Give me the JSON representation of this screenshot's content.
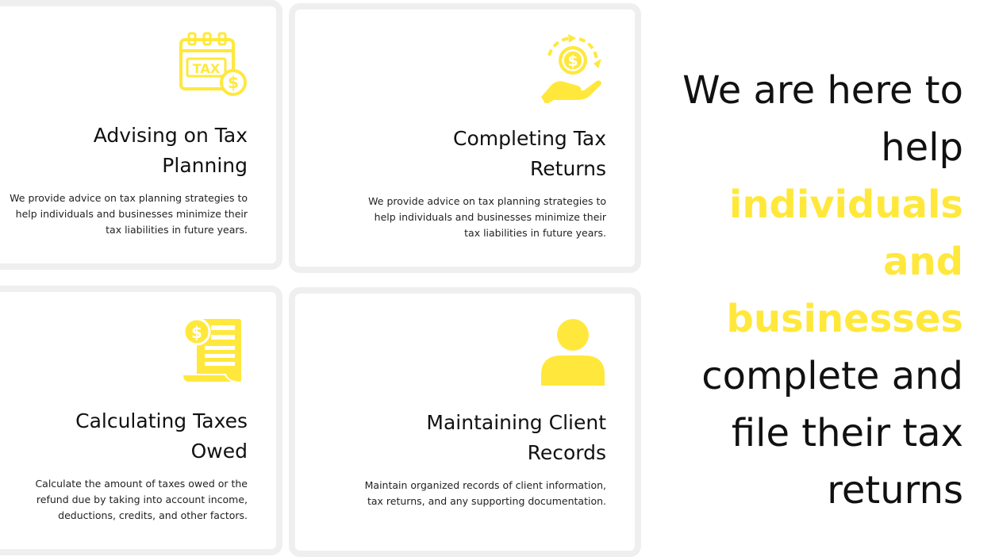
{
  "colors": {
    "accent": "#ffe83b",
    "card_border": "#efefef",
    "text": "#111111"
  },
  "cards": [
    {
      "icon": "tax-calendar-icon",
      "title_line1": "Advising on Tax",
      "title_line2": "Planning",
      "description": "We provide advice on tax planning strategies to help individuals and businesses minimize their tax liabilities in future years."
    },
    {
      "icon": "hand-coin-cycle-icon",
      "title_line1": "Completing Tax",
      "title_line2": "Returns",
      "description": "We provide advice on tax planning strategies to help individuals and businesses minimize their tax liabilities in future years."
    },
    {
      "icon": "invoice-scroll-icon",
      "title_line1": "Calculating Taxes",
      "title_line2": "Owed",
      "description": "Calculate the amount of taxes owed or the refund due by taking into account income, deductions, credits, and other factors."
    },
    {
      "icon": "person-icon",
      "title_line1": "Maintaining Client",
      "title_line2": "Records",
      "description": "Maintain organized records of client information, tax returns, and any supporting documentation."
    }
  ],
  "hero": {
    "prefix": "We are here to help ",
    "highlight": "individuals and businesses",
    "suffix": " complete and file their tax returns"
  }
}
